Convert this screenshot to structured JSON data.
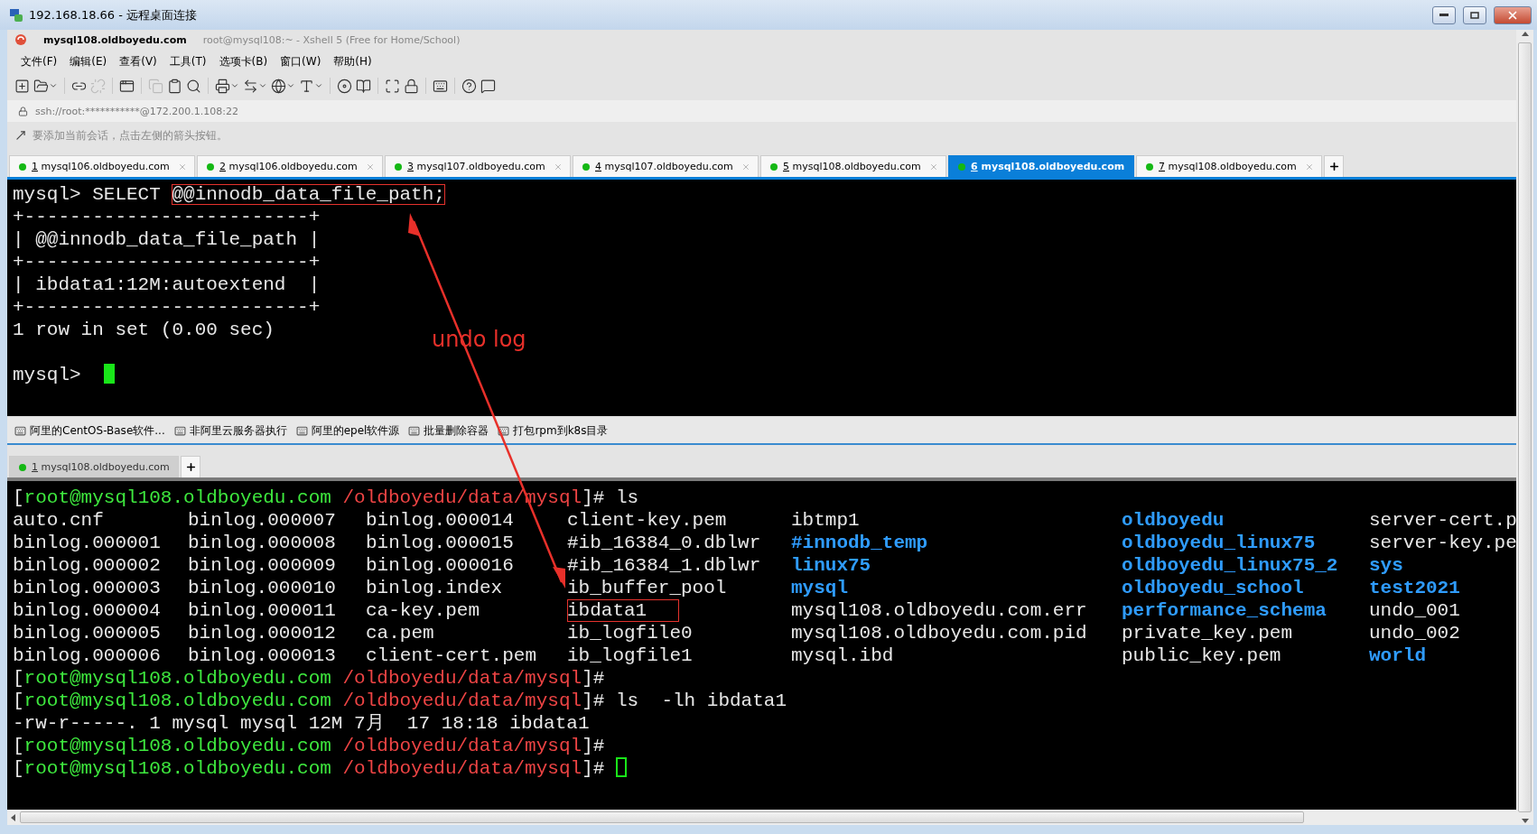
{
  "window": {
    "title": "192.168.18.66 - 远程桌面连接"
  },
  "app": {
    "session": "mysql108.oldboyedu.com",
    "subtitle": "root@mysql108:~ - Xshell 5 (Free for Home/School)"
  },
  "menu": [
    "文件(F)",
    "编辑(E)",
    "查看(V)",
    "工具(T)",
    "选项卡(B)",
    "窗口(W)",
    "帮助(H)"
  ],
  "address": {
    "value": "ssh://root:***********@172.200.1.108:22"
  },
  "hint": "要添加当前会话，点击左侧的箭头按钮。",
  "tabs": [
    {
      "number": "1",
      "label": "mysql106.oldboyedu.com",
      "selected": false
    },
    {
      "number": "2",
      "label": "mysql106.oldboyedu.com",
      "selected": false
    },
    {
      "number": "3",
      "label": "mysql107.oldboyedu.com",
      "selected": false
    },
    {
      "number": "4",
      "label": "mysql107.oldboyedu.com",
      "selected": false
    },
    {
      "number": "5",
      "label": "mysql108.oldboyedu.com",
      "selected": false
    },
    {
      "number": "6",
      "label": "mysql108.oldboyedu.com",
      "selected": true
    },
    {
      "number": "7",
      "label": "mysql108.oldboyedu.com",
      "selected": false
    }
  ],
  "top_terminal": [
    {
      "kind": "annotated",
      "text": "mysql> SELECT ",
      "boxed_text": "@@innodb_data_file_path;"
    },
    {
      "kind": "text",
      "text": "+-------------------------+"
    },
    {
      "kind": "text",
      "text": "| @@innodb_data_file_path |"
    },
    {
      "kind": "text",
      "text": "+-------------------------+"
    },
    {
      "kind": "text",
      "text": "| ibdata1:12M:autoextend  |"
    },
    {
      "kind": "text",
      "text": "+-------------------------+"
    },
    {
      "kind": "text",
      "text": "1 row in set (0.00 sec)"
    },
    {
      "kind": "blank"
    },
    {
      "kind": "text",
      "text": "mysql> ",
      "cursor": true,
      "cursor_filled": true
    }
  ],
  "annotation": {
    "label": "undo log"
  },
  "quick_commands": [
    "阿里的CentOS-Base软件...",
    "非阿里云服务器执行",
    "阿里的epel软件源",
    "批量删除容器",
    "打包rpm到k8s目录"
  ],
  "lower_tabs": [
    {
      "number": "1",
      "label": "mysql108.oldboyedu.com",
      "selected": true
    }
  ],
  "bottom_terminal": [
    {
      "kind": "prompt",
      "open": "[",
      "user_host": "root@mysql108.oldboyedu.com",
      "path": "/oldboyedu/data/mysql",
      "close": "]#",
      "command": "ls"
    },
    {
      "kind": "ls_row",
      "cells": [
        {
          "text": "auto.cnf",
          "kind": "file",
          "boxed": false
        },
        {
          "text": "binlog.000007",
          "kind": "file",
          "boxed": false
        },
        {
          "text": "binlog.000014",
          "kind": "file",
          "boxed": false
        },
        {
          "text": "client-key.pem",
          "kind": "file",
          "boxed": false
        },
        {
          "text": "ibtmp1",
          "kind": "file",
          "boxed": false
        },
        {
          "text": "oldboyedu",
          "kind": "dir",
          "boxed": false
        },
        {
          "text": "server-cert.p",
          "kind": "file",
          "boxed": false
        }
      ]
    },
    {
      "kind": "ls_row",
      "cells": [
        {
          "text": "binlog.000001",
          "kind": "file",
          "boxed": false
        },
        {
          "text": "binlog.000008",
          "kind": "file",
          "boxed": false
        },
        {
          "text": "binlog.000015",
          "kind": "file",
          "boxed": false
        },
        {
          "text": "#ib_16384_0.dblwr",
          "kind": "file",
          "boxed": false
        },
        {
          "text": "#innodb_temp",
          "kind": "dir",
          "boxed": false
        },
        {
          "text": "oldboyedu_linux75",
          "kind": "dir",
          "boxed": false
        },
        {
          "text": "server-key.pe",
          "kind": "file",
          "boxed": false
        }
      ]
    },
    {
      "kind": "ls_row",
      "cells": [
        {
          "text": "binlog.000002",
          "kind": "file",
          "boxed": false
        },
        {
          "text": "binlog.000009",
          "kind": "file",
          "boxed": false
        },
        {
          "text": "binlog.000016",
          "kind": "file",
          "boxed": false
        },
        {
          "text": "#ib_16384_1.dblwr",
          "kind": "file",
          "boxed": false
        },
        {
          "text": "linux75",
          "kind": "dir",
          "boxed": false
        },
        {
          "text": "oldboyedu_linux75_2",
          "kind": "dir",
          "boxed": false
        },
        {
          "text": "sys",
          "kind": "dir",
          "boxed": false
        }
      ]
    },
    {
      "kind": "ls_row",
      "cells": [
        {
          "text": "binlog.000003",
          "kind": "file",
          "boxed": false
        },
        {
          "text": "binlog.000010",
          "kind": "file",
          "boxed": false
        },
        {
          "text": "binlog.index",
          "kind": "file",
          "boxed": false
        },
        {
          "text": "ib_buffer_pool",
          "kind": "file",
          "boxed": false
        },
        {
          "text": "mysql",
          "kind": "dir",
          "boxed": false
        },
        {
          "text": "oldboyedu_school",
          "kind": "dir",
          "boxed": false
        },
        {
          "text": "test2021",
          "kind": "dir",
          "boxed": false
        }
      ]
    },
    {
      "kind": "ls_row",
      "cells": [
        {
          "text": "binlog.000004",
          "kind": "file",
          "boxed": false
        },
        {
          "text": "binlog.000011",
          "kind": "file",
          "boxed": false
        },
        {
          "text": "ca-key.pem",
          "kind": "file",
          "boxed": false
        },
        {
          "text": "ibdata1",
          "kind": "file",
          "boxed": true
        },
        {
          "text": "mysql108.oldboyedu.com.err",
          "kind": "file",
          "boxed": false
        },
        {
          "text": "performance_schema",
          "kind": "dir",
          "boxed": false
        },
        {
          "text": "undo_001",
          "kind": "file",
          "boxed": false
        }
      ]
    },
    {
      "kind": "ls_row",
      "cells": [
        {
          "text": "binlog.000005",
          "kind": "file",
          "boxed": false
        },
        {
          "text": "binlog.000012",
          "kind": "file",
          "boxed": false
        },
        {
          "text": "ca.pem",
          "kind": "file",
          "boxed": false
        },
        {
          "text": "ib_logfile0",
          "kind": "file",
          "boxed": false
        },
        {
          "text": "mysql108.oldboyedu.com.pid",
          "kind": "file",
          "boxed": false
        },
        {
          "text": "private_key.pem",
          "kind": "file",
          "boxed": false
        },
        {
          "text": "undo_002",
          "kind": "file",
          "boxed": false
        }
      ]
    },
    {
      "kind": "ls_row",
      "cells": [
        {
          "text": "binlog.000006",
          "kind": "file",
          "boxed": false
        },
        {
          "text": "binlog.000013",
          "kind": "file",
          "boxed": false
        },
        {
          "text": "client-cert.pem",
          "kind": "file",
          "boxed": false
        },
        {
          "text": "ib_logfile1",
          "kind": "file",
          "boxed": false
        },
        {
          "text": "mysql.ibd",
          "kind": "file",
          "boxed": false
        },
        {
          "text": "public_key.pem",
          "kind": "file",
          "boxed": false
        },
        {
          "text": "world",
          "kind": "dir",
          "boxed": false
        }
      ]
    },
    {
      "kind": "prompt",
      "open": "[",
      "user_host": "root@mysql108.oldboyedu.com",
      "path": "/oldboyedu/data/mysql",
      "close": "]#"
    },
    {
      "kind": "prompt",
      "open": "[",
      "user_host": "root@mysql108.oldboyedu.com",
      "path": "/oldboyedu/data/mysql",
      "close": "]#",
      "command": "ls  -lh ibdata1"
    },
    {
      "kind": "output",
      "text": "-rw-r-----. 1 mysql mysql 12M 7月  17 18:18 ibdata1"
    },
    {
      "kind": "prompt",
      "open": "[",
      "user_host": "root@mysql108.oldboyedu.com",
      "path": "/oldboyedu/data/mysql",
      "close": "]#"
    },
    {
      "kind": "prompt",
      "open": "[",
      "user_host": "root@mysql108.oldboyedu.com",
      "path": "/oldboyedu/data/mysql",
      "close": "]#",
      "cursor": true,
      "cursor_filled": false
    }
  ]
}
